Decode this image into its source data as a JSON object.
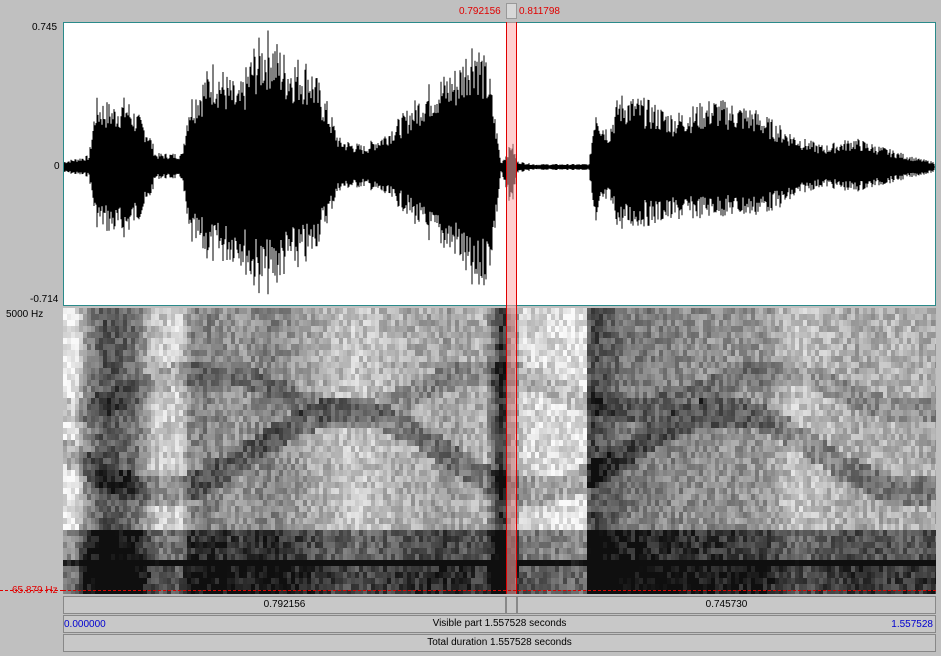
{
  "selection": {
    "start": "0.792156",
    "end": "0.811798",
    "start_seconds": 0.792156,
    "end_seconds": 0.811798
  },
  "waveform": {
    "max": "0.745",
    "zero": "0",
    "min": "-0.714"
  },
  "spectrogram": {
    "max_freq": "5000 Hz",
    "min_freq": "65.879 Hz"
  },
  "time_bars": {
    "before_selection": "0.792156",
    "after_selection": "0.745730",
    "window_start": "0.000000",
    "visible_part": "Visible part 1.557528 seconds",
    "window_end": "1.557528",
    "total_duration": "Total duration 1.557528 seconds"
  },
  "colors": {
    "selection_fill": "#ffc8c8",
    "selection_line": "#e00000",
    "window_time": "#0000d0"
  }
}
